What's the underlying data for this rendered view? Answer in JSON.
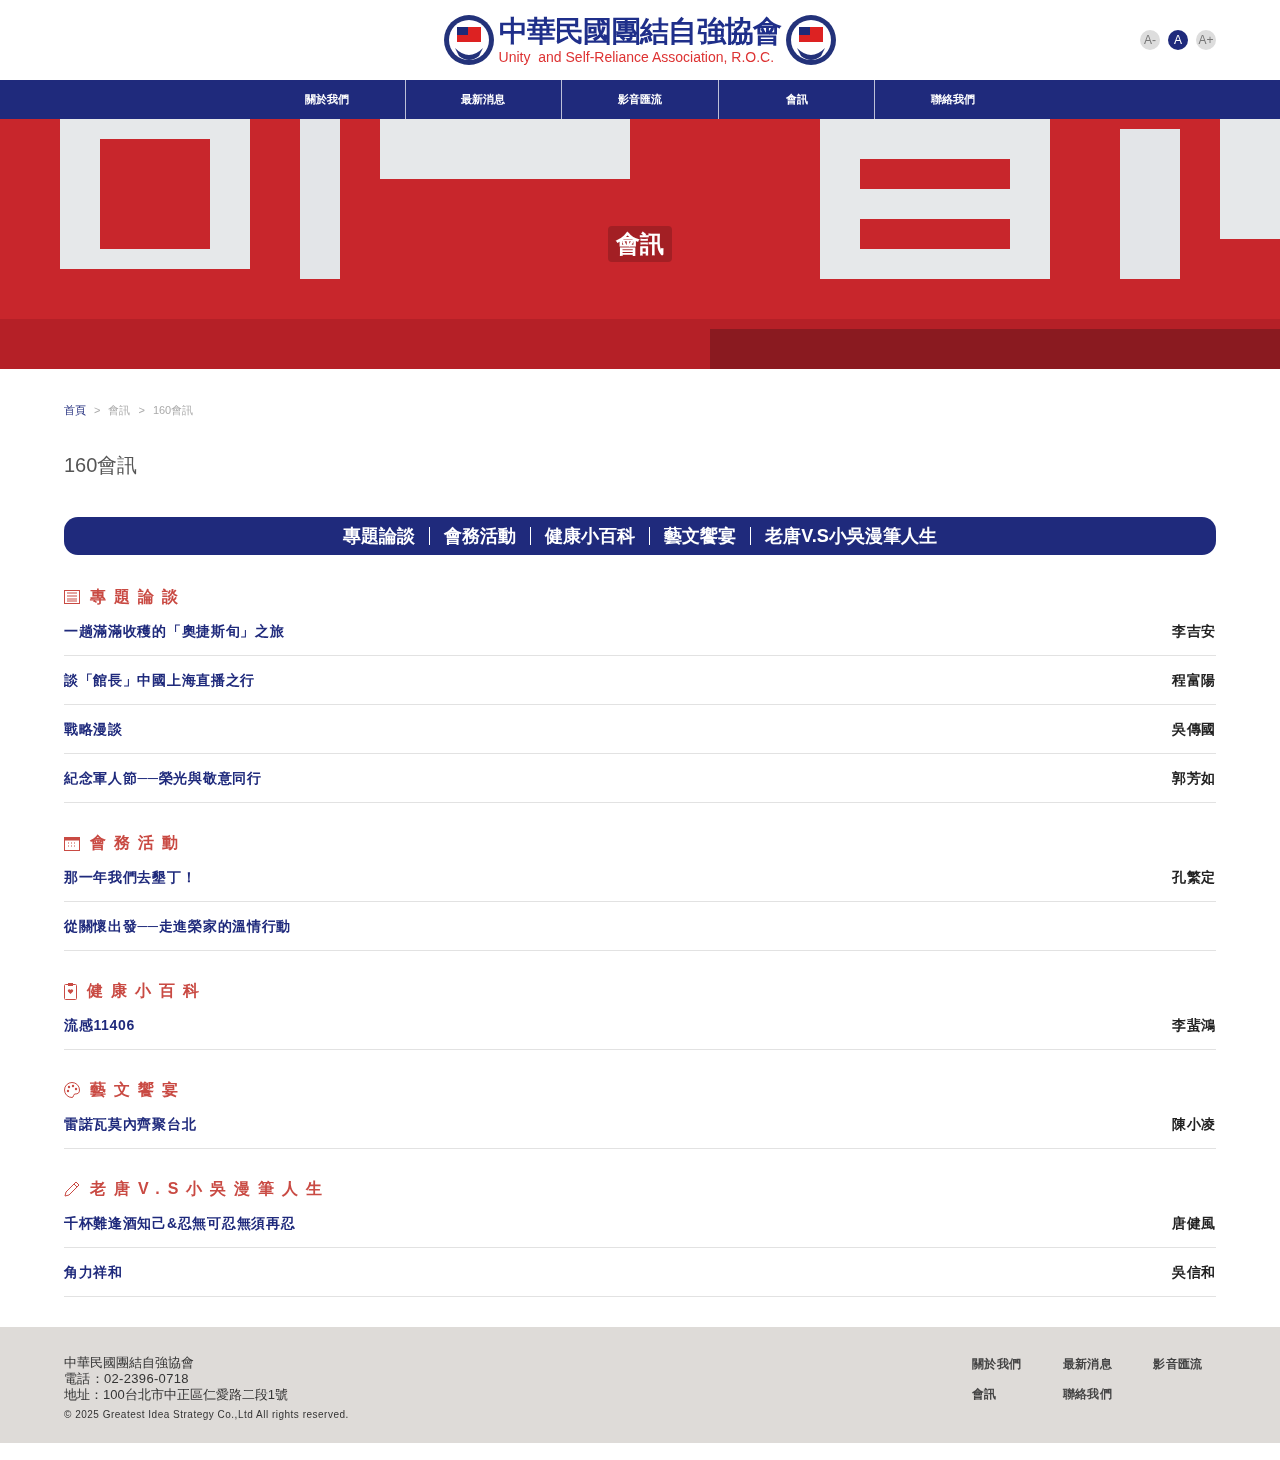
{
  "header": {
    "logo_title": "中華民國團結自強協會",
    "logo_subtitle": "Unity  and Self-Reliance Association, R.O.C.",
    "font_sizes": [
      {
        "label": "A-",
        "selected": false
      },
      {
        "label": "A",
        "selected": true
      },
      {
        "label": "A+",
        "selected": false
      }
    ]
  },
  "nav": [
    "關於我們",
    "最新消息",
    "影音匯流",
    "會訊",
    "聯絡我們"
  ],
  "hero": {
    "kind": "picture",
    "title": "會訊"
  },
  "breadcrumb": [
    "首頁",
    "會訊",
    "160會訊"
  ],
  "breadcrumb_separator": ">",
  "page_title": "160會訊",
  "category_bar": [
    "專題論談",
    "會務活動",
    "健康小百科",
    "藝文饗宴",
    "老唐V.S小吳漫筆人生"
  ],
  "sections": [
    {
      "kind": "document",
      "title": "專題論談",
      "articles": [
        {
          "title": "一趟滿滿收穫的「奧捷斯旬」之旅",
          "author": "李吉安"
        },
        {
          "title": "談「館長」中國上海直播之行",
          "author": "程富陽"
        },
        {
          "title": "戰略漫談",
          "author": "吳傳國"
        },
        {
          "title": "紀念軍人節──榮光與敬意同行",
          "author": "郭芳如"
        }
      ]
    },
    {
      "kind": "calendar",
      "title": "會務活動",
      "articles": [
        {
          "title": "那一年我們去墾丁！",
          "author": "孔繁定"
        },
        {
          "title": "從關懷出發──走進榮家的溫情行動"
        }
      ]
    },
    {
      "kind": "clipboard",
      "title": "健康小百科",
      "articles": [
        {
          "title": "流感11406",
          "author": "李蜚鴻"
        }
      ]
    },
    {
      "kind": "palette",
      "title": "藝文饗宴",
      "articles": [
        {
          "title": "雷諾瓦莫內齊聚台北",
          "author": "陳小凌"
        }
      ]
    },
    {
      "kind": "pencil",
      "title": "老唐V.S小吳漫筆人生",
      "articles": [
        {
          "title": "千杯難逢酒知己&忍無可忍無須再忍",
          "author": "唐健風"
        },
        {
          "title": "角力祥和",
          "author": "吳信和"
        }
      ]
    }
  ],
  "footer": {
    "org": "中華民國團結自強協會",
    "phone": "電話：02-2396-0718",
    "address": "地址：100台北市中正區仁愛路二段1號",
    "copyright": "© 2025 Greatest Idea Strategy Co.,Ltd All rights reserved.",
    "links": [
      "關於我們",
      "最新消息",
      "影音匯流",
      "會訊",
      "聯絡我們"
    ]
  }
}
